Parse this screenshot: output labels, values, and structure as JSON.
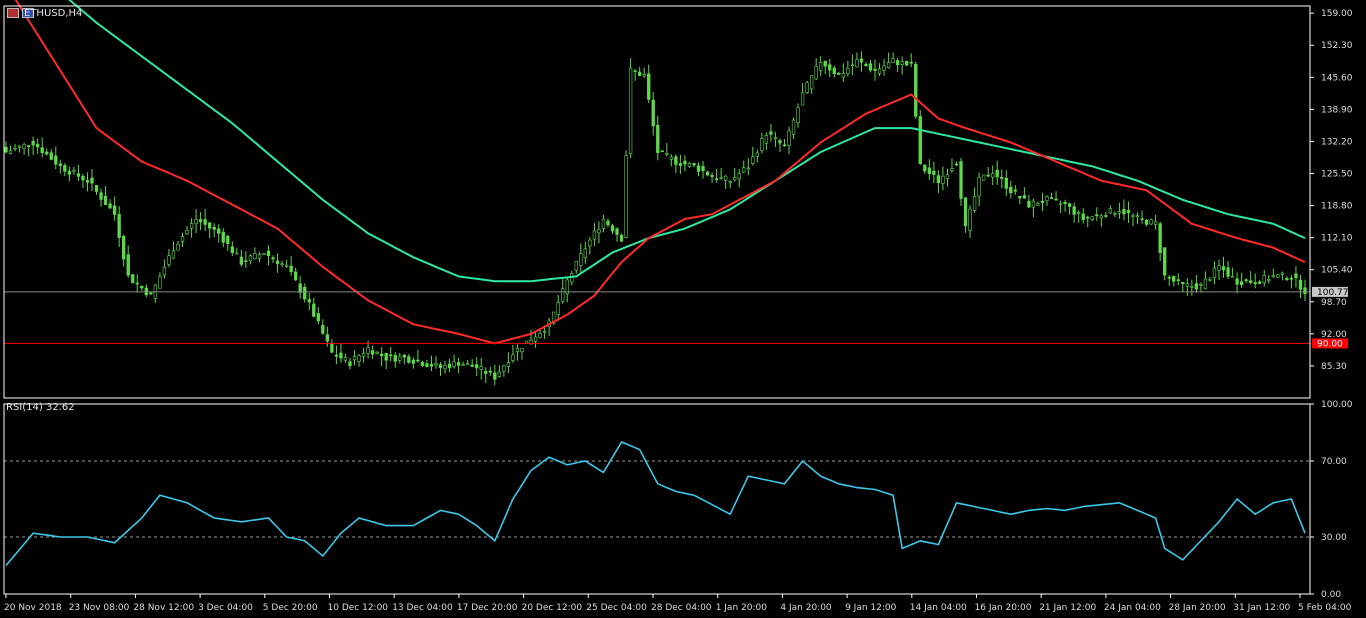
{
  "header": {
    "symbol": "ETHUSD,H4",
    "rsi_label": "RSI(14) 32.62"
  },
  "colors": {
    "background": "#000000",
    "candle": "#5ed84a",
    "ma_fast": "#ff2a2a",
    "ma_slow": "#2ee8a0",
    "rsi": "#3cc8e8",
    "price_line": "#8a8a8a",
    "support_line": "#ff0000",
    "axis": "#ffffff",
    "text": "#dcdcdc"
  },
  "chart_data": [
    {
      "type": "candlestick",
      "title": "ETHUSD,H4",
      "ylim": [
        78.6,
        160.5
      ],
      "y_ticks": [
        "159.00",
        "152.30",
        "145.60",
        "138.90",
        "132.20",
        "125.50",
        "118.80",
        "112.10",
        "105.40",
        "98.70",
        "92.00",
        "85.30"
      ],
      "x_ticks": [
        "20 Nov 2018",
        "23 Nov 08:00",
        "28 Nov 12:00",
        "3 Dec 04:00",
        "5 Dec 20:00",
        "10 Dec 12:00",
        "13 Dec 04:00",
        "17 Dec 20:00",
        "20 Dec 12:00",
        "25 Dec 04:00",
        "28 Dec 04:00",
        "1 Jan 20:00",
        "4 Jan 20:00",
        "9 Jan 12:00",
        "14 Jan 04:00",
        "16 Jan 20:00",
        "21 Jan 12:00",
        "24 Jan 04:00",
        "28 Jan 20:00",
        "31 Jan 12:00",
        "5 Feb 04:00"
      ],
      "current_price": "100.77",
      "horizontal_level": "90.00",
      "price_anchors": [
        [
          0,
          130
        ],
        [
          6,
          132
        ],
        [
          12,
          127
        ],
        [
          18,
          124
        ],
        [
          24,
          117
        ],
        [
          27,
          104
        ],
        [
          32,
          100
        ],
        [
          37,
          110
        ],
        [
          42,
          116
        ],
        [
          47,
          113
        ],
        [
          52,
          107
        ],
        [
          57,
          109
        ],
        [
          62,
          106
        ],
        [
          67,
          98
        ],
        [
          72,
          88
        ],
        [
          76,
          86
        ],
        [
          80,
          89
        ],
        [
          84,
          87
        ],
        [
          88,
          87
        ],
        [
          92,
          86
        ],
        [
          96,
          85
        ],
        [
          100,
          86
        ],
        [
          104,
          85
        ],
        [
          108,
          83
        ],
        [
          112,
          88
        ],
        [
          116,
          91
        ],
        [
          120,
          94
        ],
        [
          124,
          103
        ],
        [
          128,
          110
        ],
        [
          132,
          116
        ],
        [
          136,
          112
        ],
        [
          138,
          147
        ],
        [
          141,
          146
        ],
        [
          144,
          130
        ],
        [
          148,
          128
        ],
        [
          152,
          127
        ],
        [
          156,
          125
        ],
        [
          160,
          124
        ],
        [
          164,
          127
        ],
        [
          168,
          134
        ],
        [
          172,
          131
        ],
        [
          176,
          142
        ],
        [
          180,
          149
        ],
        [
          184,
          146
        ],
        [
          188,
          149
        ],
        [
          192,
          147
        ],
        [
          196,
          149
        ],
        [
          200,
          148
        ],
        [
          202,
          127
        ],
        [
          206,
          124
        ],
        [
          210,
          128
        ],
        [
          212,
          114
        ],
        [
          215,
          124
        ],
        [
          218,
          126
        ],
        [
          222,
          122
        ],
        [
          226,
          119
        ],
        [
          230,
          120
        ],
        [
          234,
          119
        ],
        [
          238,
          116
        ],
        [
          242,
          117
        ],
        [
          246,
          118
        ],
        [
          250,
          116
        ],
        [
          254,
          115
        ],
        [
          256,
          104
        ],
        [
          260,
          102
        ],
        [
          264,
          102
        ],
        [
          268,
          106
        ],
        [
          272,
          103
        ],
        [
          276,
          103
        ],
        [
          280,
          104
        ],
        [
          284,
          104
        ],
        [
          287,
          101
        ]
      ],
      "ma_fast_anchors": [
        [
          0,
          165
        ],
        [
          10,
          150
        ],
        [
          20,
          135
        ],
        [
          30,
          128
        ],
        [
          40,
          124
        ],
        [
          50,
          119
        ],
        [
          60,
          114
        ],
        [
          70,
          106
        ],
        [
          80,
          99
        ],
        [
          90,
          94
        ],
        [
          100,
          92
        ],
        [
          108,
          90
        ],
        [
          116,
          92
        ],
        [
          124,
          96
        ],
        [
          130,
          100
        ],
        [
          136,
          107
        ],
        [
          142,
          112
        ],
        [
          150,
          116
        ],
        [
          156,
          117
        ],
        [
          162,
          120
        ],
        [
          170,
          124
        ],
        [
          180,
          132
        ],
        [
          190,
          138
        ],
        [
          200,
          142
        ],
        [
          206,
          137
        ],
        [
          212,
          135
        ],
        [
          222,
          132
        ],
        [
          232,
          128
        ],
        [
          242,
          124
        ],
        [
          252,
          122
        ],
        [
          262,
          115
        ],
        [
          272,
          112
        ],
        [
          280,
          110
        ],
        [
          287,
          107
        ]
      ],
      "ma_slow_anchors": [
        [
          0,
          175
        ],
        [
          10,
          165
        ],
        [
          20,
          157
        ],
        [
          30,
          150
        ],
        [
          40,
          143
        ],
        [
          50,
          136
        ],
        [
          60,
          128
        ],
        [
          70,
          120
        ],
        [
          80,
          113
        ],
        [
          90,
          108
        ],
        [
          100,
          104
        ],
        [
          108,
          103
        ],
        [
          116,
          103
        ],
        [
          126,
          104
        ],
        [
          134,
          109
        ],
        [
          142,
          112
        ],
        [
          150,
          114
        ],
        [
          160,
          118
        ],
        [
          170,
          124
        ],
        [
          180,
          130
        ],
        [
          192,
          135
        ],
        [
          200,
          135
        ],
        [
          210,
          133
        ],
        [
          220,
          131
        ],
        [
          230,
          129
        ],
        [
          240,
          127
        ],
        [
          250,
          124
        ],
        [
          260,
          120
        ],
        [
          270,
          117
        ],
        [
          280,
          115
        ],
        [
          287,
          112
        ]
      ]
    },
    {
      "type": "line",
      "title": "RSI(14) 32.62",
      "ylim": [
        0,
        100
      ],
      "y_ticks": [
        "100.00",
        "70.00",
        "30.00",
        "0.00"
      ],
      "levels": [
        70,
        30
      ],
      "rsi_anchors": [
        [
          0,
          15
        ],
        [
          6,
          32
        ],
        [
          12,
          30
        ],
        [
          18,
          30
        ],
        [
          24,
          27
        ],
        [
          30,
          40
        ],
        [
          34,
          52
        ],
        [
          40,
          48
        ],
        [
          46,
          40
        ],
        [
          52,
          38
        ],
        [
          58,
          40
        ],
        [
          62,
          30
        ],
        [
          66,
          28
        ],
        [
          70,
          20
        ],
        [
          74,
          32
        ],
        [
          78,
          40
        ],
        [
          84,
          36
        ],
        [
          90,
          36
        ],
        [
          96,
          44
        ],
        [
          100,
          42
        ],
        [
          104,
          36
        ],
        [
          108,
          28
        ],
        [
          112,
          50
        ],
        [
          116,
          65
        ],
        [
          120,
          72
        ],
        [
          124,
          68
        ],
        [
          128,
          70
        ],
        [
          132,
          64
        ],
        [
          136,
          80
        ],
        [
          140,
          76
        ],
        [
          144,
          58
        ],
        [
          148,
          54
        ],
        [
          152,
          52
        ],
        [
          156,
          47
        ],
        [
          160,
          42
        ],
        [
          164,
          62
        ],
        [
          168,
          60
        ],
        [
          172,
          58
        ],
        [
          176,
          70
        ],
        [
          180,
          62
        ],
        [
          184,
          58
        ],
        [
          188,
          56
        ],
        [
          192,
          55
        ],
        [
          196,
          52
        ],
        [
          198,
          24
        ],
        [
          202,
          28
        ],
        [
          206,
          26
        ],
        [
          210,
          48
        ],
        [
          214,
          46
        ],
        [
          218,
          44
        ],
        [
          222,
          42
        ],
        [
          226,
          44
        ],
        [
          230,
          45
        ],
        [
          234,
          44
        ],
        [
          238,
          46
        ],
        [
          242,
          47
        ],
        [
          246,
          48
        ],
        [
          250,
          44
        ],
        [
          254,
          40
        ],
        [
          256,
          24
        ],
        [
          260,
          18
        ],
        [
          264,
          28
        ],
        [
          268,
          38
        ],
        [
          272,
          50
        ],
        [
          276,
          42
        ],
        [
          280,
          48
        ],
        [
          284,
          50
        ],
        [
          287,
          32
        ]
      ]
    }
  ]
}
